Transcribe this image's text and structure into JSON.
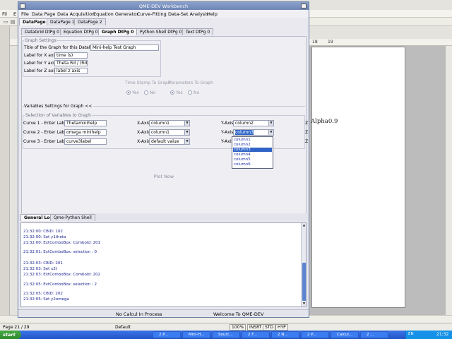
{
  "background_app": {
    "menu": [
      "Fil",
      "E"
    ],
    "ruler_numbers": [
      "18",
      "19"
    ],
    "doc_text": "Alpha0.9",
    "status": {
      "page": "Page 21 / 29",
      "style": "Default",
      "zoom": "100%",
      "insert": "INSRT",
      "std": "STD",
      "hyp": "HYP"
    }
  },
  "taskbar": {
    "start": "start",
    "tasks": [
      "2 P...",
      "Mini-H...",
      "Sourc...",
      "2 F...",
      "2 N...",
      "2 P...",
      "Calcul...",
      "2 ..."
    ],
    "lang": "EN",
    "clock": "21:32"
  },
  "window": {
    "title": "QME-DEV Workbench",
    "menu": [
      "File",
      "Data Page",
      "Data Acquisition",
      "Equation Generator",
      "Curve-Fitting",
      "Data-Set Analysis",
      "Help"
    ],
    "datapage_tabs": [
      "DataPage 0",
      "DataPage 1",
      "DataPage 2"
    ],
    "inner_tabs": [
      "DataGrid DtPg 0",
      "Equation DtPg 0",
      "Graph DtPg 0",
      "Python Shell DtPg 0",
      "Text DtPg 0"
    ],
    "graph_settings": {
      "group_title": "Graph Settings",
      "title_label": "Title of the Graph for this DataPage:",
      "title_value": "Mini-help Test Graph",
      "x_label": "Label for X axis",
      "x_value": "time (s)",
      "y_label": "Label for Y axis",
      "y_value": "Theta Rd / (Rd/s)",
      "z_label": "Label for Z axis",
      "z_value": "label z axis"
    },
    "timestamp": {
      "title": "Time Stamp To Graph",
      "yes": "Yes",
      "no": "No"
    },
    "params": {
      "title": "Parameters To Graph",
      "yes": "Yes",
      "no": "No"
    },
    "variables": {
      "section_title": "Variables Settings for Graph  <<",
      "group_title": "Selection of Variables to Graph",
      "curves": [
        {
          "label": "Curve 1 - Enter Label",
          "value": "Thetaminihelp",
          "x_axis": "X-Axis",
          "x_value": "column1",
          "y_axis": "Y-Axis",
          "y_value": "column2"
        },
        {
          "label": "Curve 2 - Enter Label",
          "value": "omega minihelp",
          "x_axis": "X-Axis",
          "x_value": "column1",
          "y_axis": "Y-Axis",
          "y_value": "column3"
        },
        {
          "label": "Curve 3 - Enter Label",
          "value": "curve3label",
          "x_axis": "X-Axis",
          "x_value": "default value",
          "y_axis": "Y-Axis",
          "y_value": ""
        }
      ],
      "z_marks": [
        "Z",
        "Z",
        "Z"
      ],
      "dropdown_options": [
        "column1",
        "column2",
        "column3",
        "column4",
        "column5",
        "column6"
      ],
      "dropdown_selected": "column3"
    },
    "plot_button": "Plot Now",
    "log_tabs": [
      "General Log",
      "Qme-Python Shell"
    ],
    "log_lines": [
      "21:32:00:  CBID: 102",
      "21:32:00:  Set y1theta",
      "21:32:00: ExtComboBox: ComboId: 201",
      "21:32:01: ExtComboBox: selection : 0",
      "",
      "21:32:03:  CBID: 201",
      "21:32:03:  Set x2t",
      "21:32:03: ExtComboBox: ComboId: 202",
      "",
      "21:32:05: ExtComboBox: selection : 2",
      "",
      "21:32:05:  CBID: 202",
      "21:32:05:  Set y2omega"
    ],
    "status_left": "No Calcul In Process",
    "status_right": "Welcome To QME-DEV"
  }
}
